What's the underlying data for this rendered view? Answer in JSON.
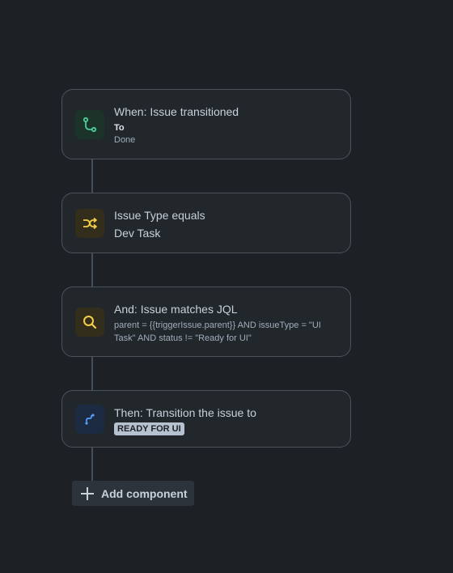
{
  "colors": {
    "background": "#1d2125",
    "card": "#22272b",
    "card_border": "#4a535c",
    "trigger_icon_bg": "#1c3329",
    "trigger_icon": "#4bce97",
    "condition_icon_bg": "#332e1b",
    "condition_icon": "#f5cd47",
    "action_icon_bg": "#1c2b42",
    "action_icon": "#579dff"
  },
  "trigger": {
    "icon": "branch-icon",
    "title": "When: Issue transitioned",
    "to_label": "To",
    "to_value": "Done"
  },
  "condition_type": {
    "icon": "shuffle-icon",
    "title": "Issue Type equals",
    "value": "Dev Task"
  },
  "condition_jql": {
    "icon": "search-icon",
    "title": "And: Issue matches JQL",
    "query": "parent = {{triggerIssue.parent}} AND issueType = \"UI Task\" AND status != \"Ready for UI\""
  },
  "action": {
    "icon": "transition-icon",
    "title": "Then: Transition the issue to",
    "status": "READY FOR UI"
  },
  "add_component": {
    "icon": "plus-icon",
    "label": "Add component"
  }
}
